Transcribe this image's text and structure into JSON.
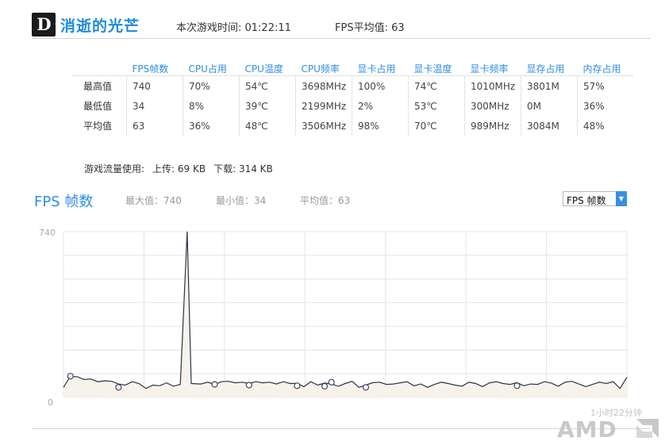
{
  "header": {
    "logo_text": "D",
    "game_title": "消逝的光芒",
    "play_time": "本次游戏时间: 01:22:11",
    "fps_avg": "FPS平均值: 63"
  },
  "stats_table": {
    "columns": [
      "FPS帧数",
      "CPU占用",
      "CPU温度",
      "CPU频率",
      "显卡占用",
      "显卡温度",
      "显卡频率",
      "显存占用",
      "内存占用"
    ],
    "rows": [
      {
        "label": "最高值",
        "values": [
          "740",
          "70%",
          "54℃",
          "3698MHz",
          "100%",
          "74℃",
          "1010MHz",
          "3801M",
          "57%"
        ]
      },
      {
        "label": "最低值",
        "values": [
          "34",
          "8%",
          "39℃",
          "2199MHz",
          "2%",
          "53℃",
          "300MHz",
          "0M",
          "36%"
        ]
      },
      {
        "label": "平均值",
        "values": [
          "63",
          "36%",
          "48℃",
          "3506MHz",
          "98%",
          "70℃",
          "989MHz",
          "3084M",
          "48%"
        ]
      }
    ]
  },
  "traffic": {
    "label": "游戏流量使用:",
    "upload": "上传: 69 KB",
    "download": "下载: 314 KB"
  },
  "chart_section": {
    "title": "FPS 帧数",
    "max": "最大值：740",
    "min": "最小值：34",
    "avg": "平均值：63",
    "select_value": "FPS 帧数",
    "duration_label": "1小时22分钟"
  },
  "brand": {
    "text": "AMD"
  },
  "colors": {
    "accent": "#2f8ee0",
    "line": "#2b3442",
    "fill": "#f7f3ea",
    "grid": "#e4e4e4"
  },
  "chart_data": {
    "type": "line",
    "title": "FPS 帧数",
    "ylim": [
      0,
      740
    ],
    "yticks": [
      "740",
      "0"
    ],
    "xlabel": "1小时22分钟",
    "grid": true,
    "x_range": [
      0,
      82
    ],
    "series": [
      {
        "values": [
          [
            0,
            45
          ],
          [
            1,
            95
          ],
          [
            2,
            92
          ],
          [
            3,
            80
          ],
          [
            4,
            82
          ],
          [
            5,
            70
          ],
          [
            6,
            74
          ],
          [
            7,
            72
          ],
          [
            8,
            60
          ],
          [
            9,
            55
          ],
          [
            10,
            70
          ],
          [
            11,
            62
          ],
          [
            12,
            40
          ],
          [
            13,
            55
          ],
          [
            14,
            52
          ],
          [
            15,
            65
          ],
          [
            16,
            50
          ],
          [
            17,
            58
          ],
          [
            18,
            740
          ],
          [
            18.6,
            62
          ],
          [
            20,
            60
          ],
          [
            21,
            68
          ],
          [
            22,
            58
          ],
          [
            23,
            70
          ],
          [
            24,
            72
          ],
          [
            25,
            65
          ],
          [
            26,
            68
          ],
          [
            27,
            62
          ],
          [
            28,
            70
          ],
          [
            29,
            65
          ],
          [
            30,
            68
          ],
          [
            31,
            60
          ],
          [
            32,
            70
          ],
          [
            33,
            62
          ],
          [
            34,
            63
          ],
          [
            35,
            48
          ],
          [
            36,
            70
          ],
          [
            37,
            55
          ],
          [
            38,
            64
          ],
          [
            39,
            60
          ],
          [
            40,
            50
          ],
          [
            41,
            62
          ],
          [
            42,
            72
          ],
          [
            43,
            45
          ],
          [
            44,
            55
          ],
          [
            45,
            66
          ],
          [
            46,
            68
          ],
          [
            47,
            58
          ],
          [
            48,
            60
          ],
          [
            49,
            65
          ],
          [
            50,
            70
          ],
          [
            51,
            52
          ],
          [
            52,
            60
          ],
          [
            53,
            45
          ],
          [
            54,
            58
          ],
          [
            55,
            68
          ],
          [
            56,
            62
          ],
          [
            57,
            55
          ],
          [
            58,
            50
          ],
          [
            59,
            68
          ],
          [
            60,
            62
          ],
          [
            61,
            48
          ],
          [
            62,
            65
          ],
          [
            63,
            70
          ],
          [
            64,
            62
          ],
          [
            65,
            58
          ],
          [
            66,
            66
          ],
          [
            67,
            52
          ],
          [
            68,
            60
          ],
          [
            69,
            58
          ],
          [
            70,
            70
          ],
          [
            71,
            64
          ],
          [
            72,
            50
          ],
          [
            73,
            68
          ],
          [
            74,
            72
          ],
          [
            75,
            60
          ],
          [
            76,
            48
          ],
          [
            77,
            58
          ],
          [
            78,
            68
          ],
          [
            79,
            62
          ],
          [
            80,
            70
          ],
          [
            81,
            40
          ],
          [
            82,
            90
          ]
        ],
        "markers": [
          [
            1,
            95
          ],
          [
            8,
            45
          ],
          [
            22,
            58
          ],
          [
            27,
            55
          ],
          [
            34,
            52
          ],
          [
            38,
            50
          ],
          [
            39,
            68
          ],
          [
            44,
            45
          ],
          [
            66,
            52
          ]
        ]
      }
    ]
  }
}
